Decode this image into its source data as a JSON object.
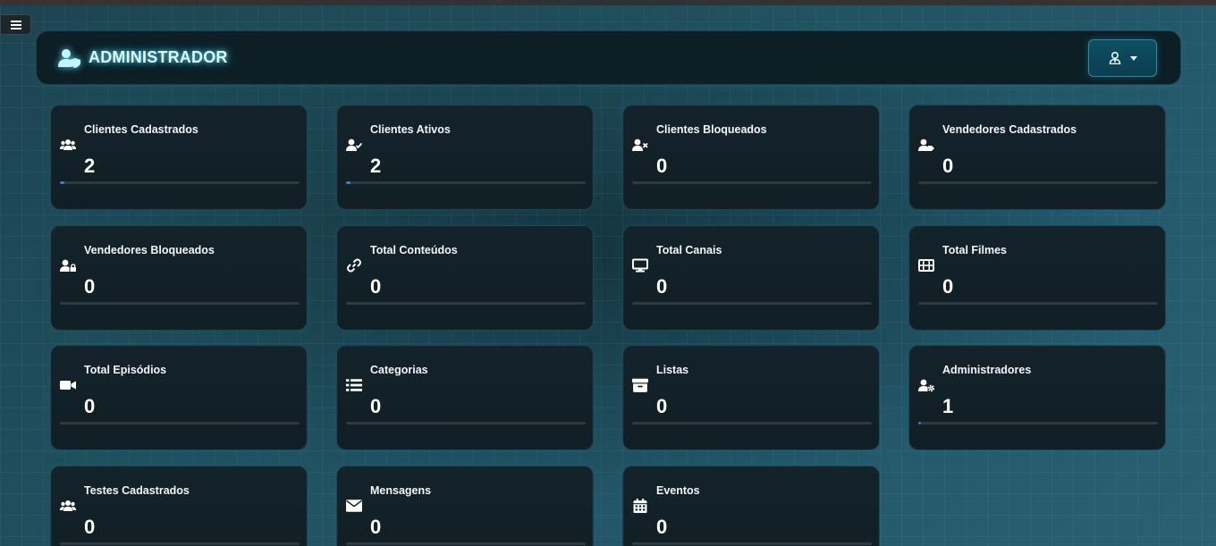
{
  "header": {
    "title": "ADMINISTRADOR",
    "icon": "user-shield-icon",
    "user_menu_icon": "user-tie-icon"
  },
  "accent_color": "#3a7bd5",
  "cards": [
    {
      "label": "Clientes Cadastrados",
      "value": "2",
      "icon": "users-icon",
      "progress_pct": 2
    },
    {
      "label": "Clientes Ativos",
      "value": "2",
      "icon": "user-check-icon",
      "progress_pct": 2
    },
    {
      "label": "Clientes Bloqueados",
      "value": "0",
      "icon": "user-times-icon",
      "progress_pct": 0
    },
    {
      "label": "Vendedores Cadastrados",
      "value": "0",
      "icon": "user-tag-icon",
      "progress_pct": 0
    },
    {
      "label": "Vendedores Bloqueados",
      "value": "0",
      "icon": "user-lock-icon",
      "progress_pct": 0
    },
    {
      "label": "Total Conteúdos",
      "value": "0",
      "icon": "link-icon",
      "progress_pct": 0
    },
    {
      "label": "Total Canais",
      "value": "0",
      "icon": "desktop-icon",
      "progress_pct": 0
    },
    {
      "label": "Total Filmes",
      "value": "0",
      "icon": "film-icon",
      "progress_pct": 0
    },
    {
      "label": "Total Episódios",
      "value": "0",
      "icon": "video-icon",
      "progress_pct": 0
    },
    {
      "label": "Categorias",
      "value": "0",
      "icon": "list-icon",
      "progress_pct": 0
    },
    {
      "label": "Listas",
      "value": "0",
      "icon": "archive-icon",
      "progress_pct": 0
    },
    {
      "label": "Administradores",
      "value": "1",
      "icon": "user-cog-icon",
      "progress_pct": 1
    },
    {
      "label": "Testes Cadastrados",
      "value": "0",
      "icon": "users-icon",
      "progress_pct": 0
    },
    {
      "label": "Mensagens",
      "value": "0",
      "icon": "envelope-icon",
      "progress_pct": 0
    },
    {
      "label": "Eventos",
      "value": "0",
      "icon": "calendar-icon",
      "progress_pct": 0
    }
  ]
}
